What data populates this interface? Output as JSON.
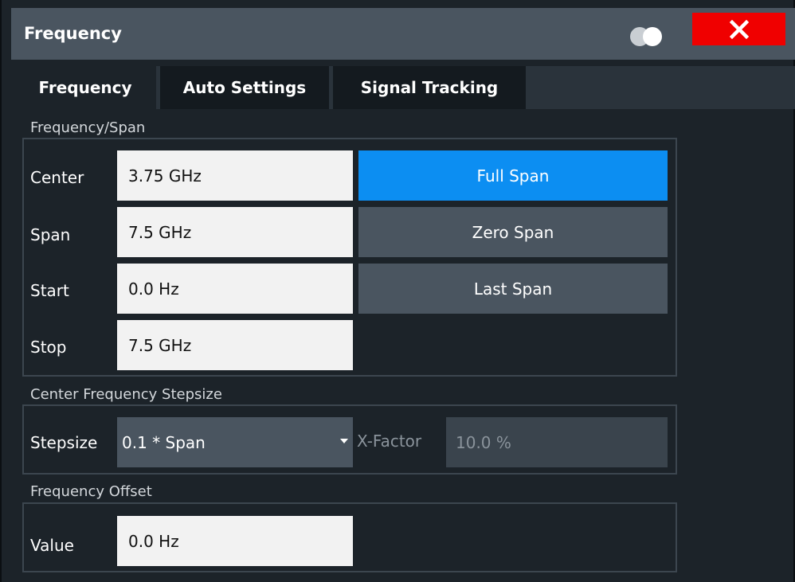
{
  "window": {
    "title": "Frequency"
  },
  "tabs": [
    {
      "label": "Frequency",
      "active": true
    },
    {
      "label": "Auto Settings",
      "active": false
    },
    {
      "label": "Signal Tracking",
      "active": false
    }
  ],
  "frequency_span": {
    "section_label": "Frequency/Span",
    "rows": [
      {
        "label": "Center",
        "value": "3.75 GHz"
      },
      {
        "label": "Span",
        "value": "7.5 GHz"
      },
      {
        "label": "Start",
        "value": "0.0 Hz"
      },
      {
        "label": "Stop",
        "value": "7.5 GHz"
      }
    ],
    "buttons": [
      {
        "label": "Full Span",
        "highlighted": true
      },
      {
        "label": "Zero Span",
        "highlighted": false
      },
      {
        "label": "Last Span",
        "highlighted": false
      }
    ]
  },
  "stepsize": {
    "section_label": "Center Frequency Stepsize",
    "label": "Stepsize",
    "selected": "0.1 * Span",
    "xfactor_label": "X-Factor",
    "xfactor_value": "10.0 %"
  },
  "offset": {
    "section_label": "Frequency Offset",
    "label": "Value",
    "value": "0.0 Hz"
  },
  "colors": {
    "accent": "#0c8ef2",
    "close": "#f00000",
    "background": "#1c2329",
    "button": "#4a5560"
  }
}
